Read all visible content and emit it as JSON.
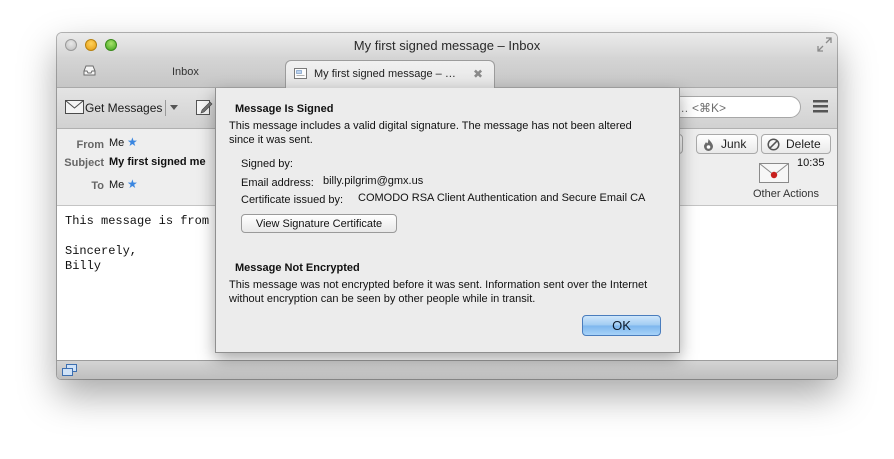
{
  "window": {
    "title": "My first signed message – Inbox"
  },
  "tabs": [
    {
      "label": "Inbox",
      "icon": "inbox-tray-icon",
      "active": false
    },
    {
      "label": "My first signed message – …",
      "icon": "message-document-icon",
      "active": true
    }
  ],
  "toolbar": {
    "get_messages_label": "Get Messages",
    "search_placeholder": "Search… <⌘K>",
    "search_visible_text": "ch… <⌘K>"
  },
  "header": {
    "from_label": "From",
    "from_value": "Me",
    "subject_label": "Subject",
    "subject_value": "My first signed me",
    "to_label": "To",
    "to_value": "Me",
    "buttons": {
      "reply_partial": "e",
      "junk": "Junk",
      "delete": "Delete"
    },
    "time": "10:35",
    "other_actions": "Other Actions"
  },
  "message_body": {
    "line1": "This message is from",
    "line2": "",
    "line3": "Sincerely,",
    "line4": "Billy"
  },
  "dialog": {
    "signed_heading": "Message Is Signed",
    "signed_text": "This message includes a valid digital signature. The message has not been altered since it was sent.",
    "signed_by_label": "Signed by:",
    "email_label": "Email address:",
    "email_value": "billy.pilgrim@gmx.us",
    "issuer_label": "Certificate issued by:",
    "issuer_value": "COMODO RSA Client Authentication and Secure Email CA",
    "view_cert_button": "View Signature Certificate",
    "encrypted_heading": "Message Not Encrypted",
    "encrypted_text": "This message was not encrypted before it was sent. Information sent over the Internet without encryption can be seen by other people while in transit.",
    "ok_button": "OK"
  },
  "colors": {
    "accent_blue": "#7db7ee",
    "star_blue": "#3a86e0",
    "dialog_bg": "#ececec"
  }
}
